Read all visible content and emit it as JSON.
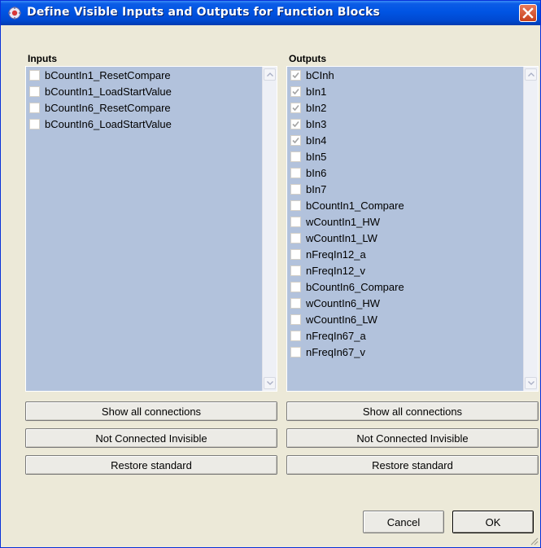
{
  "window": {
    "title": "Define Visible Inputs and Outputs for Function Blocks",
    "app_icon": "settings-app-icon",
    "close_icon": "close-icon"
  },
  "inputs": {
    "label": "Inputs",
    "items": [
      {
        "label": "bCountIn1_ResetCompare",
        "checked": false
      },
      {
        "label": "bCountIn1_LoadStartValue",
        "checked": false
      },
      {
        "label": "bCountIn6_ResetCompare",
        "checked": false
      },
      {
        "label": "bCountIn6_LoadStartValue",
        "checked": false
      }
    ]
  },
  "outputs": {
    "label": "Outputs",
    "items": [
      {
        "label": "bCInh",
        "checked": true
      },
      {
        "label": "bIn1",
        "checked": true
      },
      {
        "label": "bIn2",
        "checked": true
      },
      {
        "label": "bIn3",
        "checked": true
      },
      {
        "label": "bIn4",
        "checked": true
      },
      {
        "label": "bIn5",
        "checked": false
      },
      {
        "label": "bIn6",
        "checked": false
      },
      {
        "label": "bIn7",
        "checked": false
      },
      {
        "label": "bCountIn1_Compare",
        "checked": false
      },
      {
        "label": "wCountIn1_HW",
        "checked": false
      },
      {
        "label": "wCountIn1_LW",
        "checked": false
      },
      {
        "label": "nFreqIn12_a",
        "checked": false
      },
      {
        "label": "nFreqIn12_v",
        "checked": false
      },
      {
        "label": "bCountIn6_Compare",
        "checked": false
      },
      {
        "label": "wCountIn6_HW",
        "checked": false
      },
      {
        "label": "wCountIn6_LW",
        "checked": false
      },
      {
        "label": "nFreqIn67_a",
        "checked": false
      },
      {
        "label": "nFreqIn67_v",
        "checked": false
      }
    ]
  },
  "buttons": {
    "show_all": "Show all connections",
    "not_connected_invisible": "Not Connected Invisible",
    "restore_standard": "Restore standard",
    "cancel": "Cancel",
    "ok": "OK"
  },
  "colors": {
    "title_bar": "#0054e3",
    "list_background": "#b2c2dc",
    "dialog_background": "#ece9d8",
    "close_button": "#d2542b"
  }
}
